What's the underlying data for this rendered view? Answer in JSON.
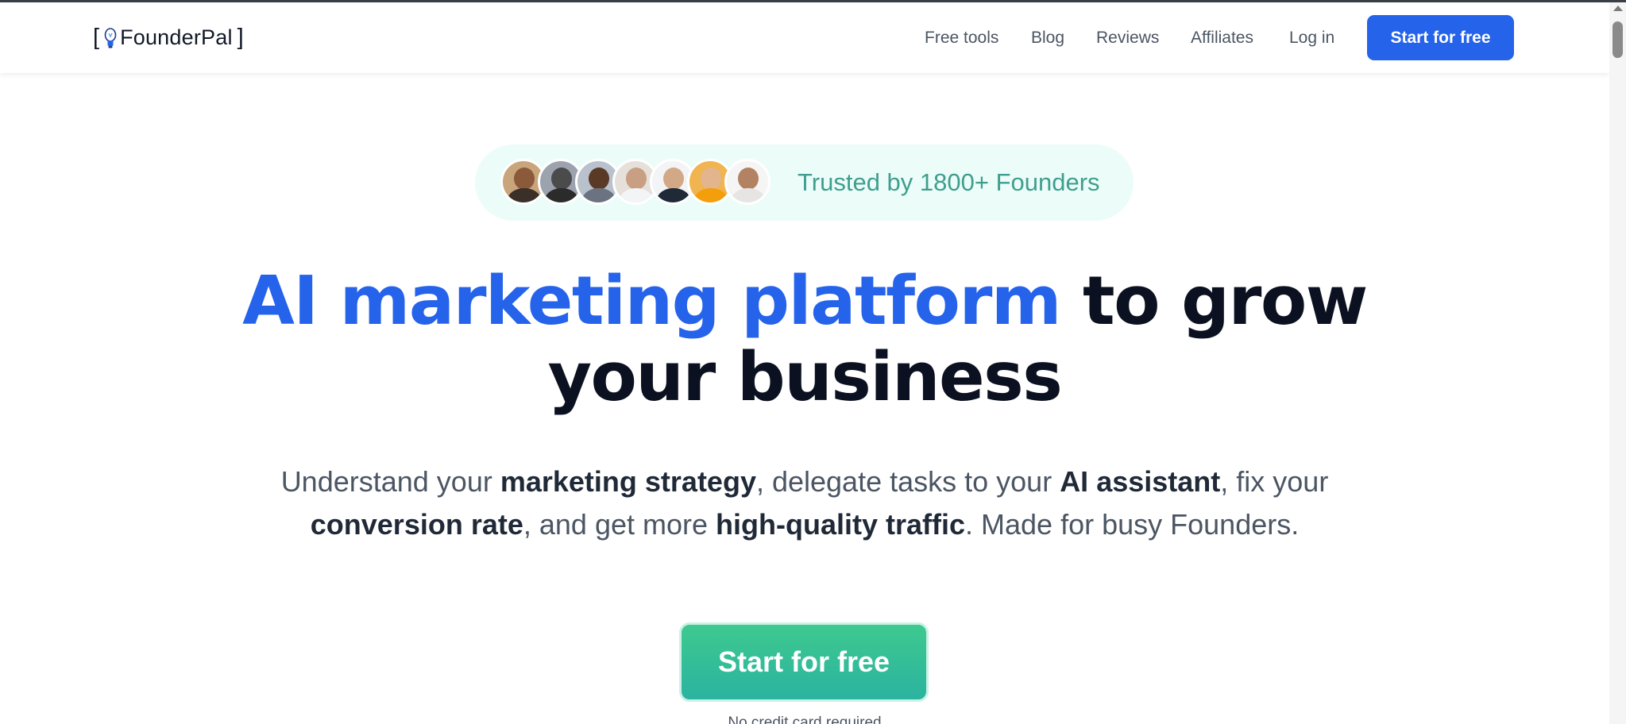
{
  "brand": {
    "name": "FounderPal",
    "bracket_open": "[",
    "bracket_close": "]",
    "icon": "lightbulb-icon"
  },
  "nav": {
    "links": [
      "Free tools",
      "Blog",
      "Reviews",
      "Affiliates",
      "Log in"
    ],
    "cta": "Start for free"
  },
  "trust": {
    "text": "Trusted by 1800+ Founders",
    "avatar_count": 7
  },
  "hero": {
    "headline_highlight": "AI marketing platform",
    "headline_rest_line1": " to grow",
    "headline_line2": "your business",
    "subtitle": {
      "p1": "Understand your ",
      "b1": "marketing strategy",
      "p2": ", delegate tasks to your ",
      "b2": "AI assistant",
      "p3": ", fix your ",
      "b3": "conversion rate",
      "p4": ", and get more ",
      "b4": "high-quality traffic",
      "p5": ". Made for busy Founders."
    },
    "cta": "Start for free",
    "note": "No credit card required"
  },
  "colors": {
    "accent": "#2563eb",
    "cta_green": "#34c095",
    "trust_bg": "#ecfdf9",
    "trust_text": "#3f9e8f"
  }
}
